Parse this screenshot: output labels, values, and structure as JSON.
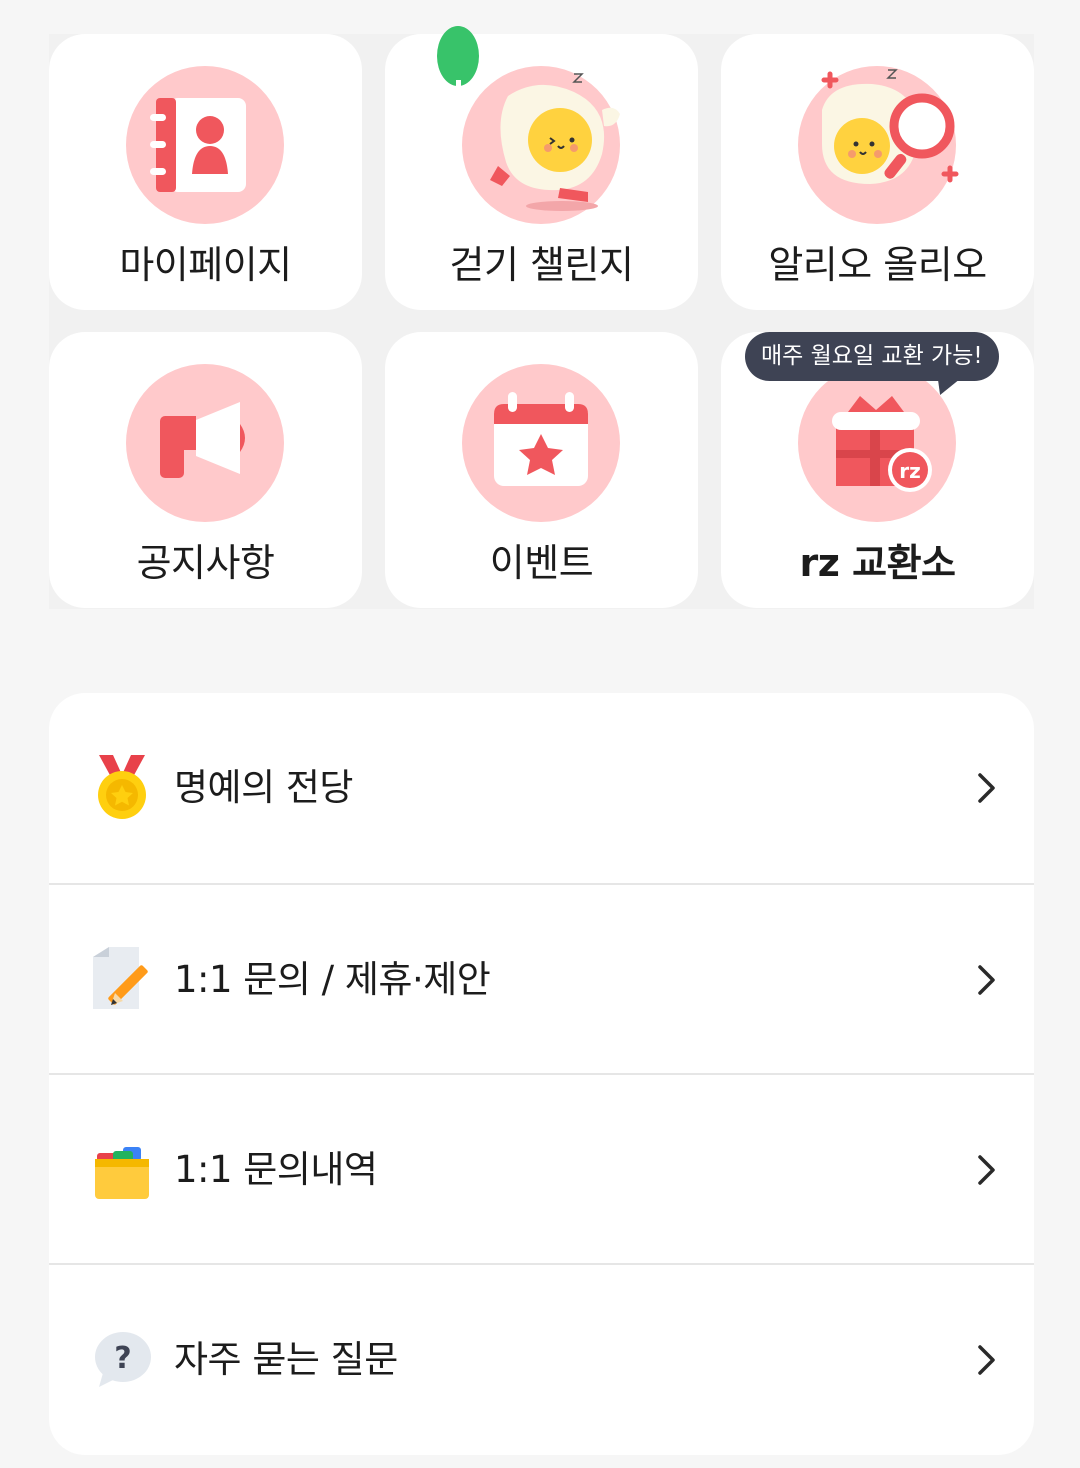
{
  "tiles": [
    {
      "label": "마이페이지",
      "icon": "address-book-icon"
    },
    {
      "label": "걷기 챌린지",
      "icon": "walking-egg-icon"
    },
    {
      "label": "알리오 올리오",
      "icon": "egg-magnifier-icon"
    },
    {
      "label": "공지사항",
      "icon": "megaphone-icon"
    },
    {
      "label": "이벤트",
      "icon": "calendar-star-icon"
    },
    {
      "label": "rz 교환소",
      "icon": "gift-rz-icon"
    }
  ],
  "tooltip": "매주 월요일 교환 가능!",
  "menu": [
    {
      "label": "명예의 전당",
      "icon": "medal-icon"
    },
    {
      "label": "1:1 문의 / 제휴·제안",
      "icon": "memo-pencil-icon"
    },
    {
      "label": "1:1 문의내역",
      "icon": "folder-icon"
    },
    {
      "label": "자주 묻는 질문",
      "icon": "question-bubble-icon"
    }
  ],
  "colors": {
    "accent": "#f0575d",
    "icon_bg": "#ffc9cb",
    "tooltip_bg": "#3e4354",
    "page_bg": "#f6f6f6"
  }
}
